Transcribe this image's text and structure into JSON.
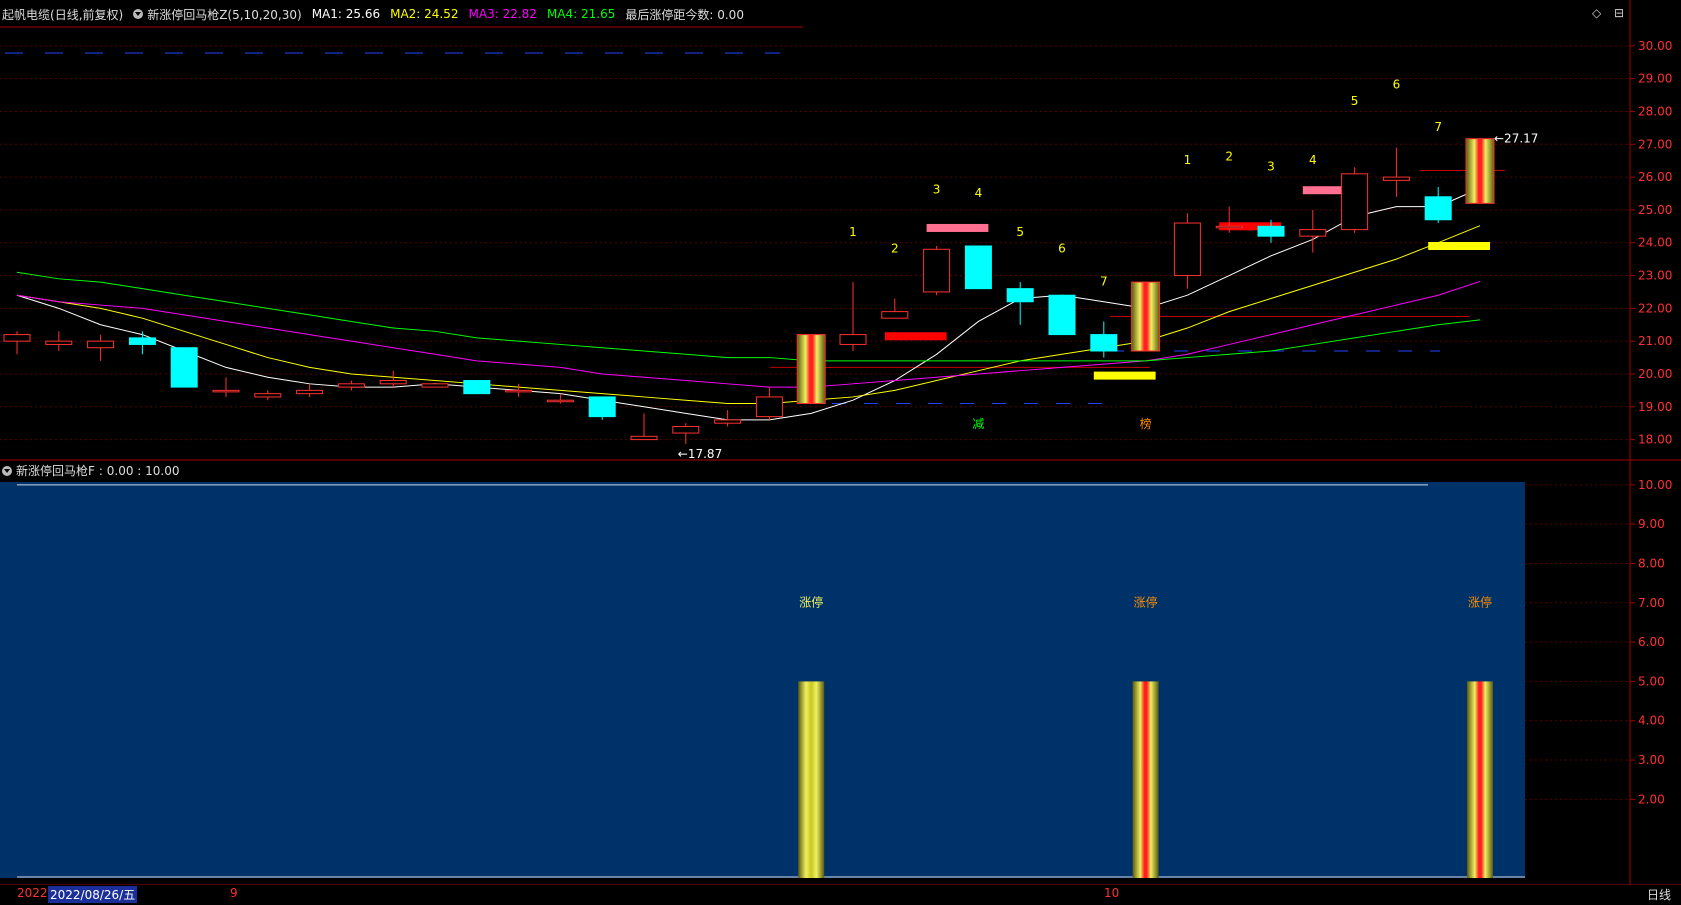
{
  "header": {
    "stock_name": "起帆电缆",
    "period_info": "(日线,前复权)",
    "indicator": "新涨停回马枪Z(5,10,20,30)",
    "ma1": "MA1: 25.66",
    "ma2": "MA2: 24.52",
    "ma3": "MA3: 22.82",
    "ma4": "MA4: 21.65",
    "last_limit": "最后涨停距今数: 0.00"
  },
  "sub_indicator": {
    "label": "新涨停回马枪F",
    "range": ": 0.00 : 10.00"
  },
  "price_axis": [
    "30.00",
    "29.00",
    "28.00",
    "27.00",
    "26.00",
    "25.00",
    "24.00",
    "23.00",
    "22.00",
    "21.00",
    "20.00",
    "19.00",
    "18.00"
  ],
  "sub_axis": [
    "10.00",
    "9.00",
    "8.00",
    "7.00",
    "6.00",
    "5.00",
    "4.00",
    "3.00",
    "2.00"
  ],
  "annotations": {
    "high_price": "27.17",
    "low_price": "17.87",
    "cycle_a": [
      "1",
      "2",
      "3",
      "4",
      "5",
      "6",
      "7"
    ],
    "cycle_b": [
      "1",
      "2",
      "3",
      "4",
      "5",
      "6",
      "7"
    ],
    "marker_1": "减",
    "marker_2": "榜",
    "limit_up": "涨停"
  },
  "bottom": {
    "year": "2022",
    "cursor_date": "2022/08/26/五",
    "month_9": "9",
    "month_10": "10",
    "period": "日线"
  },
  "colors": {
    "background": "#000000",
    "sub_background": "#00326a",
    "up": "#ff3030",
    "down": "#00ffff",
    "ma1": "#ffffff",
    "ma2": "#ffff00",
    "ma3": "#ff00ff",
    "ma4": "#00ff00",
    "axis_text": "#ff3030"
  },
  "chart_data": {
    "type": "candlestick",
    "y_range": [
      17.5,
      30.3
    ],
    "candles": [
      {
        "o": 21.0,
        "h": 21.3,
        "l": 20.6,
        "c": 21.2
      },
      {
        "o": 20.9,
        "h": 21.3,
        "l": 20.7,
        "c": 21.0
      },
      {
        "o": 20.8,
        "h": 21.2,
        "l": 20.4,
        "c": 21.0
      },
      {
        "o": 21.1,
        "h": 21.3,
        "l": 20.6,
        "c": 20.9
      },
      {
        "o": 20.8,
        "h": 20.8,
        "l": 19.6,
        "c": 19.6
      },
      {
        "o": 19.5,
        "h": 19.9,
        "l": 19.3,
        "c": 19.5
      },
      {
        "o": 19.3,
        "h": 19.5,
        "l": 19.2,
        "c": 19.4
      },
      {
        "o": 19.4,
        "h": 19.7,
        "l": 19.3,
        "c": 19.5
      },
      {
        "o": 19.6,
        "h": 19.8,
        "l": 19.5,
        "c": 19.7
      },
      {
        "o": 19.7,
        "h": 20.1,
        "l": 19.6,
        "c": 19.8
      },
      {
        "o": 19.6,
        "h": 19.7,
        "l": 19.6,
        "c": 19.7
      },
      {
        "o": 19.8,
        "h": 19.8,
        "l": 19.4,
        "c": 19.4
      },
      {
        "o": 19.5,
        "h": 19.7,
        "l": 19.3,
        "c": 19.5
      },
      {
        "o": 19.2,
        "h": 19.4,
        "l": 19.1,
        "c": 19.2
      },
      {
        "o": 19.3,
        "h": 19.3,
        "l": 18.6,
        "c": 18.7
      },
      {
        "o": 18.0,
        "h": 18.8,
        "l": 18.0,
        "c": 18.1
      },
      {
        "o": 18.2,
        "h": 18.5,
        "l": 17.87,
        "c": 18.4
      },
      {
        "o": 18.5,
        "h": 18.9,
        "l": 18.4,
        "c": 18.6
      },
      {
        "o": 18.7,
        "h": 19.6,
        "l": 18.6,
        "c": 19.3
      },
      {
        "o": 19.1,
        "h": 21.2,
        "l": 19.1,
        "c": 21.2
      },
      {
        "o": 20.9,
        "h": 22.8,
        "l": 20.7,
        "c": 21.2
      },
      {
        "o": 21.7,
        "h": 22.3,
        "l": 21.7,
        "c": 21.9
      },
      {
        "o": 22.5,
        "h": 23.9,
        "l": 22.4,
        "c": 23.8
      },
      {
        "o": 23.9,
        "h": 23.9,
        "l": 22.6,
        "c": 22.6
      },
      {
        "o": 22.6,
        "h": 22.8,
        "l": 21.5,
        "c": 22.2
      },
      {
        "o": 22.4,
        "h": 22.4,
        "l": 21.2,
        "c": 21.2
      },
      {
        "o": 21.2,
        "h": 21.6,
        "l": 20.5,
        "c": 20.7
      },
      {
        "o": 20.7,
        "h": 22.8,
        "l": 20.7,
        "c": 22.8
      },
      {
        "o": 23.0,
        "h": 24.9,
        "l": 22.6,
        "c": 24.6
      },
      {
        "o": 24.5,
        "h": 25.1,
        "l": 24.3,
        "c": 24.5
      },
      {
        "o": 24.5,
        "h": 24.7,
        "l": 24.0,
        "c": 24.2
      },
      {
        "o": 24.2,
        "h": 25.0,
        "l": 23.7,
        "c": 24.4
      },
      {
        "o": 24.4,
        "h": 26.3,
        "l": 24.3,
        "c": 26.1
      },
      {
        "o": 25.9,
        "h": 26.9,
        "l": 25.4,
        "c": 26.0
      },
      {
        "o": 25.4,
        "h": 25.7,
        "l": 24.6,
        "c": 24.7
      },
      {
        "o": 25.2,
        "h": 27.17,
        "l": 25.2,
        "c": 27.17
      }
    ],
    "limit_up_indices": [
      19,
      27,
      35
    ],
    "ma_series": [
      {
        "name": "MA1",
        "values": [
          22.4,
          22.0,
          21.5,
          21.2,
          20.7,
          20.2,
          19.9,
          19.7,
          19.6,
          19.6,
          19.7,
          19.6,
          19.5,
          19.4,
          19.2,
          19.0,
          18.8,
          18.6,
          18.6,
          18.8,
          19.2,
          19.8,
          20.6,
          21.6,
          22.3,
          22.4,
          22.2,
          22.0,
          22.4,
          23.0,
          23.6,
          24.1,
          24.8,
          25.1,
          25.1,
          25.66
        ]
      },
      {
        "name": "MA2",
        "values": [
          22.4,
          22.2,
          22.0,
          21.7,
          21.3,
          20.9,
          20.5,
          20.2,
          20.0,
          19.9,
          19.8,
          19.7,
          19.6,
          19.5,
          19.4,
          19.3,
          19.2,
          19.1,
          19.1,
          19.2,
          19.3,
          19.5,
          19.8,
          20.1,
          20.4,
          20.6,
          20.8,
          21.0,
          21.4,
          21.9,
          22.3,
          22.7,
          23.1,
          23.5,
          24.0,
          24.52
        ]
      },
      {
        "name": "MA3",
        "values": [
          22.4,
          22.2,
          22.1,
          22.0,
          21.8,
          21.6,
          21.4,
          21.2,
          21.0,
          20.8,
          20.6,
          20.4,
          20.3,
          20.2,
          20.0,
          19.9,
          19.8,
          19.7,
          19.6,
          19.6,
          19.7,
          19.8,
          19.9,
          20.0,
          20.1,
          20.2,
          20.3,
          20.4,
          20.6,
          20.9,
          21.2,
          21.5,
          21.8,
          22.1,
          22.4,
          22.82
        ]
      },
      {
        "name": "MA4",
        "values": [
          23.1,
          22.9,
          22.8,
          22.6,
          22.4,
          22.2,
          22.0,
          21.8,
          21.6,
          21.4,
          21.3,
          21.1,
          21.0,
          20.9,
          20.8,
          20.7,
          20.6,
          20.5,
          20.5,
          20.4,
          20.4,
          20.4,
          20.4,
          20.4,
          20.4,
          20.4,
          20.4,
          20.4,
          20.5,
          20.6,
          20.7,
          20.9,
          21.1,
          21.3,
          21.5,
          21.65
        ]
      }
    ]
  }
}
